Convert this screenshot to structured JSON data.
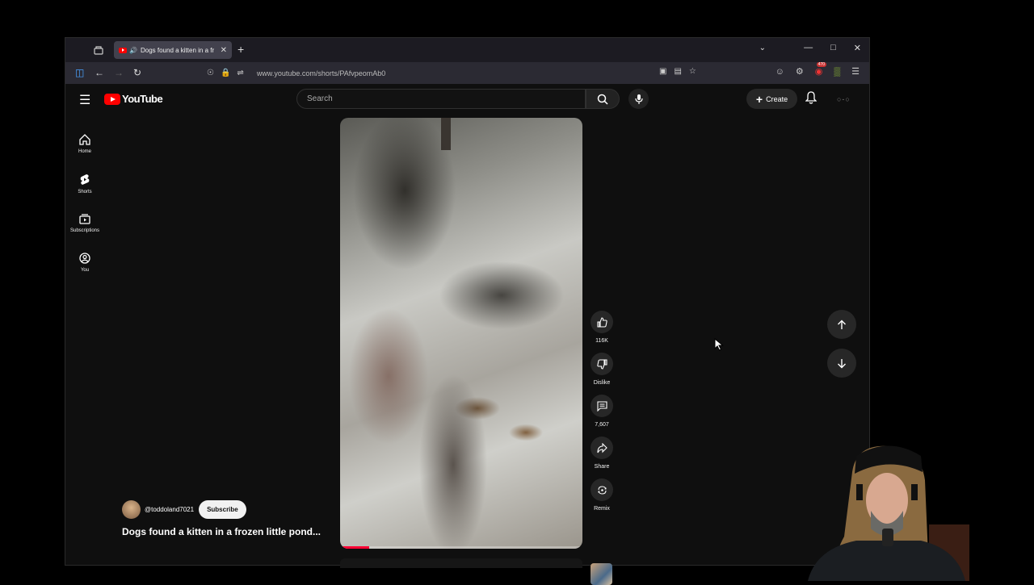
{
  "browser": {
    "tab_title": "Dogs found a kitten in a fr",
    "url": "www.youtube.com/shorts/PAfvpeomAb0",
    "extension_badge": "470"
  },
  "youtube": {
    "logo_text": "YouTube",
    "search_placeholder": "Search",
    "create_label": "Create",
    "sidebar": [
      {
        "label": "Home",
        "icon": "home-icon"
      },
      {
        "label": "Shorts",
        "icon": "shorts-icon"
      },
      {
        "label": "Subscriptions",
        "icon": "subscriptions-icon"
      },
      {
        "label": "You",
        "icon": "you-icon"
      }
    ],
    "actions": {
      "like_count": "116K",
      "dislike_label": "Dislike",
      "comment_count": "7,607",
      "share_label": "Share",
      "remix_label": "Remix"
    },
    "channel": {
      "handle": "@toddoland7021",
      "subscribe_label": "Subscribe"
    },
    "video_title": "Dogs found a kitten in a frozen little pond...",
    "progress_fraction": 0.12
  },
  "colors": {
    "brand_red": "#ff0000",
    "background": "#0f0f0f",
    "progress": "#ff0033"
  }
}
